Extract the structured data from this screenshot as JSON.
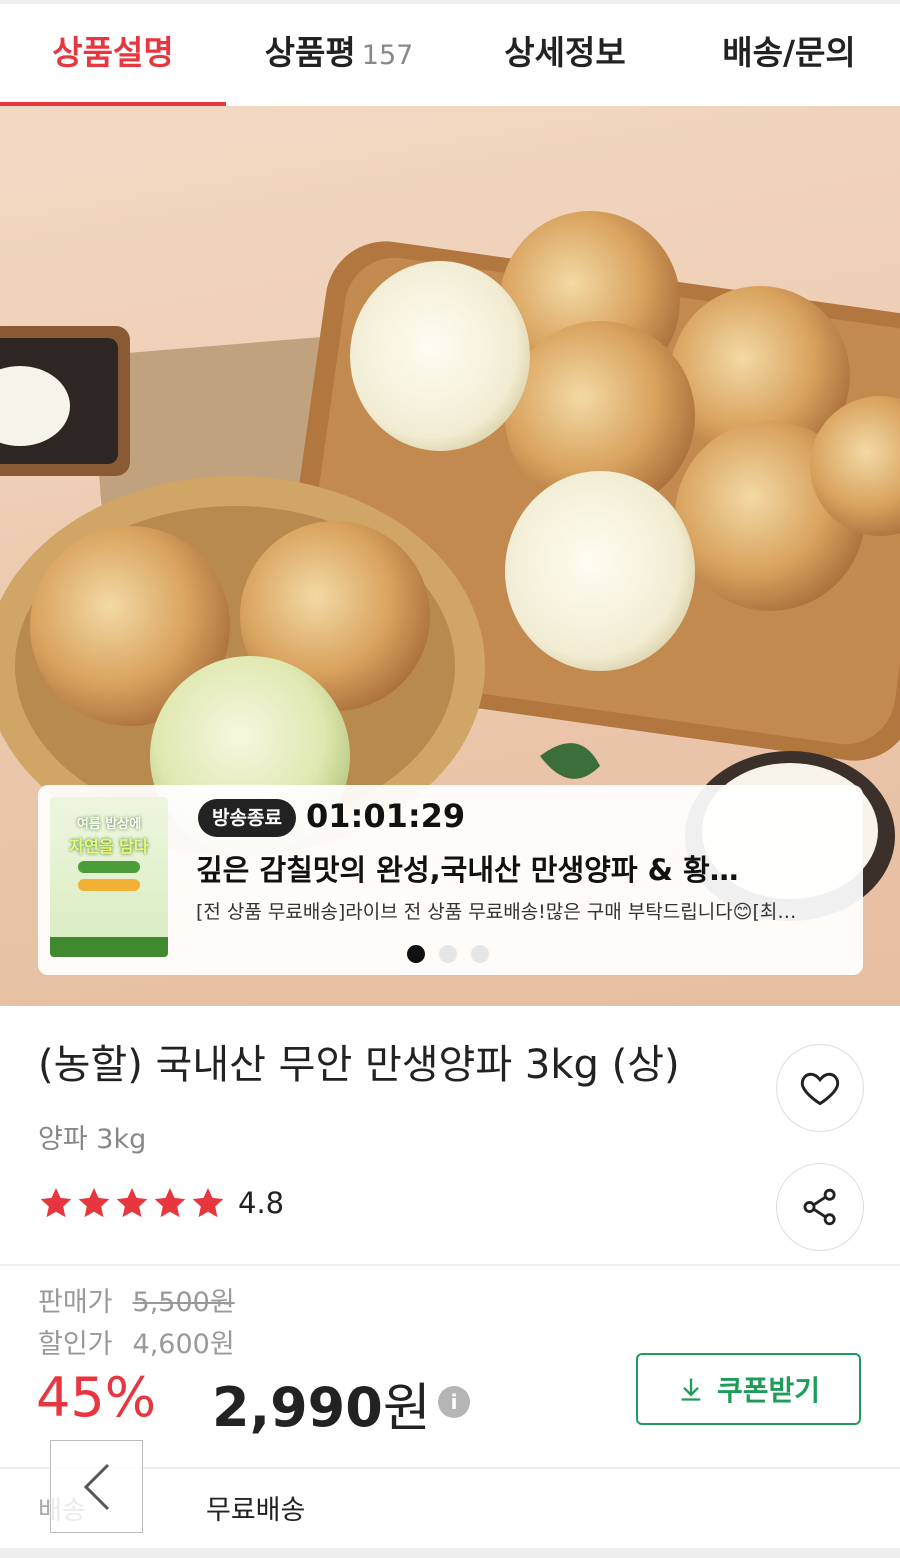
{
  "tabs": [
    {
      "label": "상품설명",
      "count": "",
      "active": true
    },
    {
      "label": "상품평",
      "count": "157",
      "active": false
    },
    {
      "label": "상세정보",
      "count": "",
      "active": false
    },
    {
      "label": "배송/문의",
      "count": "",
      "active": false
    }
  ],
  "hero": {
    "image": "onion-product-photo"
  },
  "live": {
    "thumb_line1": "여름 밥상에",
    "thumb_line2": "자연을 담다",
    "badge": "방송종료",
    "timer": "01:01:29",
    "title": "깊은 감칠맛의 완성,국내산 만생양파 & 황…",
    "subtitle": "[전 상품 무료배송]라이브 전 상품 무료배송!많은 구매 부탁드립니다😊[최…",
    "slide_index": 1,
    "slide_count": 3
  },
  "product": {
    "name": "(농할) 국내산 무안 만생양파 3kg (상)",
    "option": "양파 3kg",
    "rating": "4.8",
    "stars": 5
  },
  "price": {
    "original_label": "판매가",
    "original_value": "5,500원",
    "discount_label": "할인가",
    "discount_value": "4,600원",
    "rate": "45%",
    "final_amount": "2,990",
    "final_unit": "원",
    "info_icon": "i",
    "coupon_label": "쿠폰받기"
  },
  "shipping": {
    "label": "배송",
    "value": "무료배송"
  },
  "colors": {
    "accent": "#e8363f",
    "coupon": "#1e9c5a",
    "star": "#e8363f"
  }
}
